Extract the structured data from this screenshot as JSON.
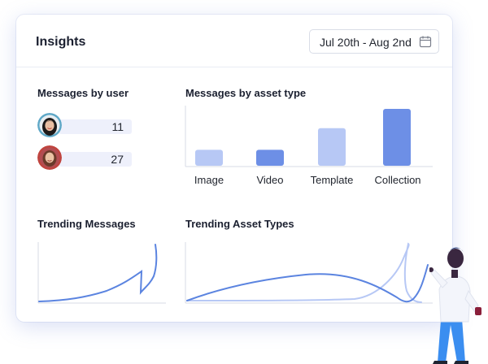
{
  "header": {
    "title": "Insights",
    "date_range": "Jul 20th - Aug 2nd"
  },
  "messages_by_user": {
    "title": "Messages by user",
    "users": [
      {
        "count": "11"
      },
      {
        "count": "27"
      }
    ]
  },
  "messages_by_asset_type": {
    "title": "Messages by asset type",
    "chart_data": {
      "type": "bar",
      "categories": [
        "Image",
        "Video",
        "Template",
        "Collection"
      ],
      "values": [
        2.8,
        2.8,
        6.6,
        10
      ],
      "colors": [
        "#b7c8f5",
        "#6d8fe6",
        "#b7c8f5",
        "#6d8fe6"
      ]
    }
  },
  "trending_messages": {
    "title": "Trending Messages"
  },
  "trending_asset_types": {
    "title": "Trending Asset Types"
  },
  "colors": {
    "accent": "#6d8fe6",
    "accent_light": "#b7c8f5",
    "line": "#5b84e0"
  },
  "icons": {
    "date_button": "calendar-icon"
  }
}
